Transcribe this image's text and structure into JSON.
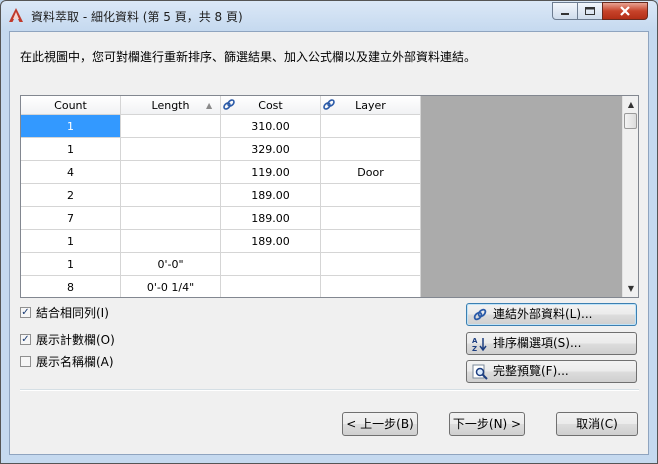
{
  "window": {
    "title": "資料萃取 - 細化資料 (第 5 頁，共 8 頁)"
  },
  "instruction": "在此視圖中，您可對欄進行重新排序、篩選結果、加入公式欄以及建立外部資料連結。",
  "table": {
    "columns": [
      {
        "label": "Count",
        "sort_indicator": "",
        "icon": ""
      },
      {
        "label": "Length",
        "sort_indicator": "▲",
        "icon": ""
      },
      {
        "label": "Cost",
        "sort_indicator": "",
        "icon": "link-icon"
      },
      {
        "label": "Layer",
        "sort_indicator": "",
        "icon": "link-icon"
      }
    ],
    "rows": [
      {
        "count": "1",
        "length": "",
        "cost": "310.00",
        "layer": ""
      },
      {
        "count": "1",
        "length": "",
        "cost": "329.00",
        "layer": ""
      },
      {
        "count": "4",
        "length": "",
        "cost": "119.00",
        "layer": "Door"
      },
      {
        "count": "2",
        "length": "",
        "cost": "189.00",
        "layer": ""
      },
      {
        "count": "7",
        "length": "",
        "cost": "189.00",
        "layer": ""
      },
      {
        "count": "1",
        "length": "",
        "cost": "189.00",
        "layer": ""
      },
      {
        "count": "1",
        "length": "0'-0\"",
        "cost": "",
        "layer": ""
      },
      {
        "count": "8",
        "length": "0'-0 1/4\"",
        "cost": "",
        "layer": ""
      }
    ],
    "selected_cell": "row 1, Count"
  },
  "options": {
    "combine_rows": {
      "label": "結合相同列(I)",
      "checked": true
    },
    "show_count": {
      "label": "展示計數欄(O)",
      "checked": true
    },
    "show_name": {
      "label": "展示名稱欄(A)",
      "checked": false
    }
  },
  "side_buttons": {
    "link_external": "連結外部資料(L)...",
    "sort_options": "排序欄選項(S)...",
    "full_preview": "完整預覽(F)..."
  },
  "footer": {
    "back": "< 上一步(B)",
    "next": "下一步(N) >",
    "cancel": "取消(C)"
  },
  "colors": {
    "selection": "#3399ff",
    "grid_background": "#ababab",
    "app_icon": "#c0392b"
  }
}
